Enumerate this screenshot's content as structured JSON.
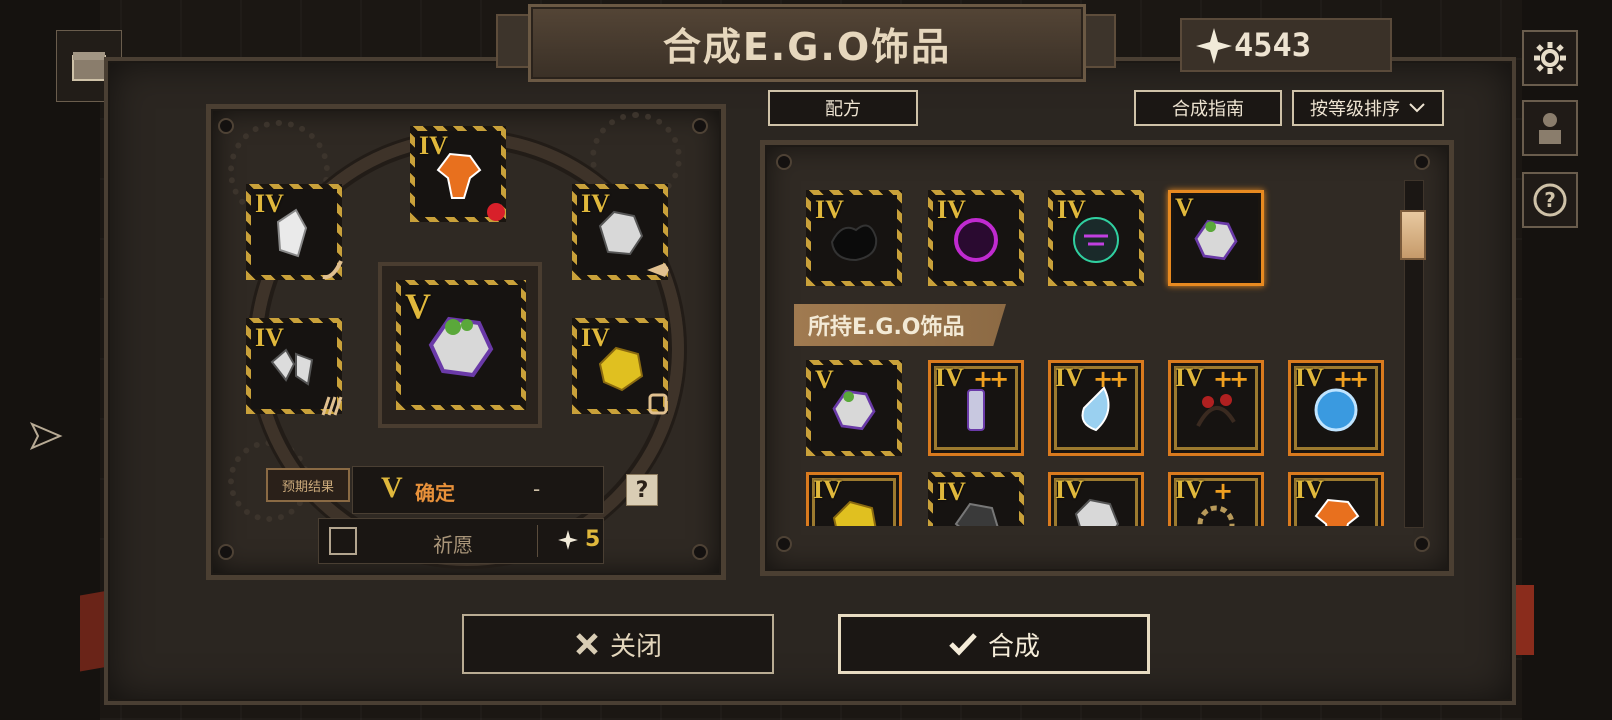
{
  "title": "合成E.G.O饰品",
  "currency": {
    "amount": "4543",
    "icon": "star-icon"
  },
  "buttons": {
    "recipe": "配方",
    "guide": "合成指南",
    "sort": "按等级排序",
    "close": "关闭",
    "craft": "合成"
  },
  "craft": {
    "result_label": "预期结果",
    "result_tier": "V",
    "result_status": "确定",
    "result_value": "-",
    "help": "?",
    "wish_label": "祈愿",
    "wish_cost": "5"
  },
  "slots": {
    "top": {
      "tier": "IV",
      "icon": "orange-crystal-icon"
    },
    "upper_left": {
      "tier": "IV",
      "icon": "white-shard-icon"
    },
    "upper_right": {
      "tier": "IV",
      "icon": "grey-rock-icon"
    },
    "lower_left": {
      "tier": "IV",
      "icon": "broken-shards-icon"
    },
    "center": {
      "tier": "V",
      "icon": "ore-with-leaves-icon"
    },
    "lower_right": {
      "tier": "IV",
      "icon": "gold-ore-icon"
    }
  },
  "recipe_items": [
    {
      "tier": "IV",
      "icon": "black-smoke-icon"
    },
    {
      "tier": "IV",
      "icon": "purple-swirl-icon"
    },
    {
      "tier": "IV",
      "icon": "neon-mask-icon"
    },
    {
      "tier": "V",
      "icon": "ore-with-leaves-icon"
    }
  ],
  "owned_header": "所持E.G.O饰品",
  "owned_items": [
    {
      "tier": "V",
      "plus": "",
      "icon": "ore-with-leaves-icon"
    },
    {
      "tier": "IV",
      "plus": "++",
      "icon": "potion-bottle-icon"
    },
    {
      "tier": "IV",
      "plus": "++",
      "icon": "water-drop-icon"
    },
    {
      "tier": "IV",
      "plus": "++",
      "icon": "rose-vine-icon"
    },
    {
      "tier": "IV",
      "plus": "++",
      "icon": "blue-orb-icon"
    },
    {
      "tier": "IV",
      "plus": "",
      "icon": "gold-ore-icon"
    },
    {
      "tier": "IV",
      "plus": "",
      "icon": "dark-mass-icon"
    },
    {
      "tier": "IV",
      "plus": "",
      "icon": "grey-rock-icon"
    },
    {
      "tier": "IV",
      "plus": "+",
      "icon": "gear-hand-icon"
    },
    {
      "tier": "IV",
      "plus": "",
      "icon": "orange-crystal-icon"
    }
  ],
  "colors": {
    "accent_gold": "#e0b83c",
    "accent_orange": "#e88a20",
    "panel": "#2b2621"
  }
}
